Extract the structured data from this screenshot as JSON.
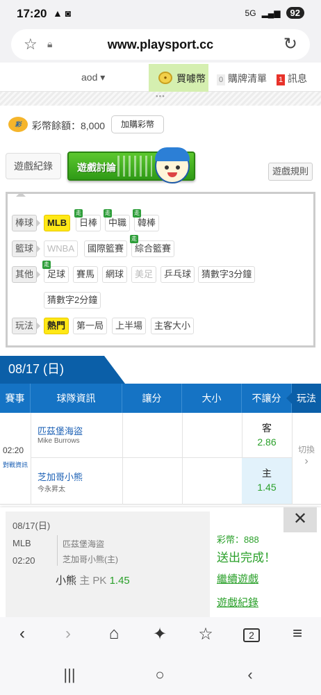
{
  "status": {
    "time": "17:20",
    "icons": "▲ ◙",
    "network": "5G",
    "signal": "📶",
    "battery": "92"
  },
  "browser": {
    "url": "www.playsport.cc"
  },
  "topnav": {
    "user": "aod ▾",
    "buy_label": "買噱幣",
    "cart_count": "0",
    "cart_label": "購牌清單",
    "msg_count": "1",
    "msg_label": "訊息"
  },
  "balance": {
    "text": "彩幣餘額：8,000",
    "buy_btn": "加購彩幣",
    "icon_text": "彩"
  },
  "gametabs": {
    "record": "遊戲紀錄",
    "discussion": "遊戲討論",
    "rules": "遊戲規則"
  },
  "filters": {
    "baseball": {
      "cat": "棒球",
      "items": [
        "MLB",
        "日棒",
        "中職",
        "韓棒"
      ]
    },
    "basketball": {
      "cat": "籃球",
      "items": [
        "WNBA",
        "國際籃賽",
        "綜合籃賽"
      ]
    },
    "other": {
      "cat": "其他",
      "items": [
        "足球",
        "賽馬",
        "網球",
        "美足",
        "乒乓球",
        "猜數字3分鐘",
        "猜數字2分鐘"
      ]
    },
    "play": {
      "cat": "玩法",
      "items": [
        "熱門",
        "第一局",
        "上半場",
        "主客大小"
      ]
    },
    "walk_badge": "走"
  },
  "date": "08/17 (日)",
  "columns": [
    "賽事",
    "球隊資訊",
    "讓分",
    "大小",
    "不讓分",
    "玩法"
  ],
  "game": {
    "time": "02:20",
    "link": "對戰資訊",
    "away": {
      "team": "匹茲堡海盜",
      "pitcher": "Mike Burrows",
      "side": "客",
      "odds": "2.86"
    },
    "home": {
      "team": "芝加哥小熊",
      "pitcher": "今永昇太",
      "side": "主",
      "odds": "1.45"
    },
    "switch": "切換",
    "switch_arrow": "›"
  },
  "popup": {
    "date": "08/17(日)",
    "league": "MLB",
    "time": "02:20",
    "team1": "匹茲堡海盜",
    "team2": "芝加哥小熊(主)",
    "pick_team": "小熊",
    "pick_side": "主",
    "pick_type": "PK",
    "pick_odds": "1.45",
    "coins": "彩幣：888",
    "done": "送出完成！",
    "continue": "繼續遊戲",
    "records": "遊戲紀錄",
    "close": "✕"
  },
  "browserbar": [
    "‹",
    "›",
    "⌂",
    "✦",
    "☆",
    "2",
    "≡"
  ],
  "navbar": [
    "|||",
    "○",
    "‹"
  ]
}
